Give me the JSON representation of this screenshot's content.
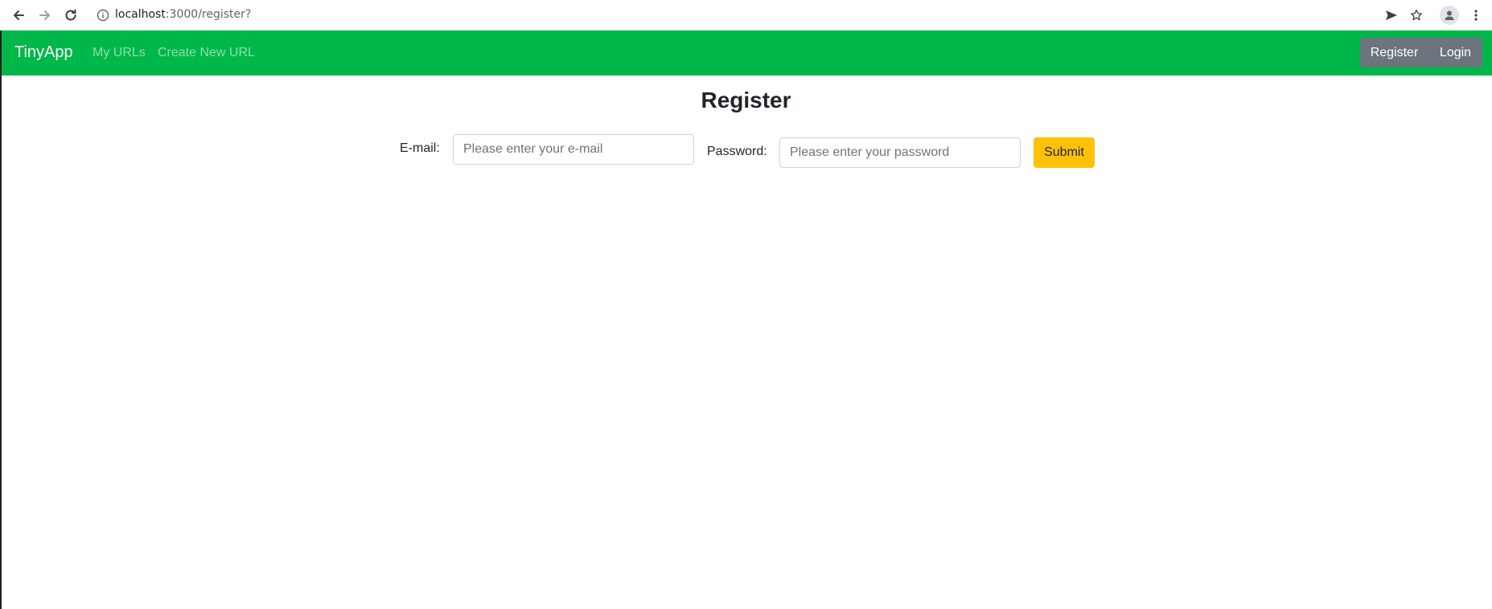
{
  "browser": {
    "url_host": "localhost",
    "url_rest": ":3000/register?",
    "icons": {
      "back": "arrow-left-icon",
      "forward": "arrow-right-icon",
      "reload": "reload-icon",
      "site_info": "info-icon",
      "send": "send-icon",
      "bookmark": "star-icon",
      "profile": "profile-icon",
      "menu": "kebab-menu-icon"
    }
  },
  "navbar": {
    "brand": "TinyApp",
    "links": [
      "My URLs",
      "Create New URL"
    ],
    "auth": {
      "register": "Register",
      "login": "Login"
    },
    "color": "#00b74a"
  },
  "main": {
    "title": "Register",
    "email_label": "E-mail:",
    "email_placeholder": "Please enter your e-mail",
    "password_label": "Password:",
    "password_placeholder": "Please enter your password",
    "submit_label": "Submit",
    "submit_color": "#ffc107"
  }
}
